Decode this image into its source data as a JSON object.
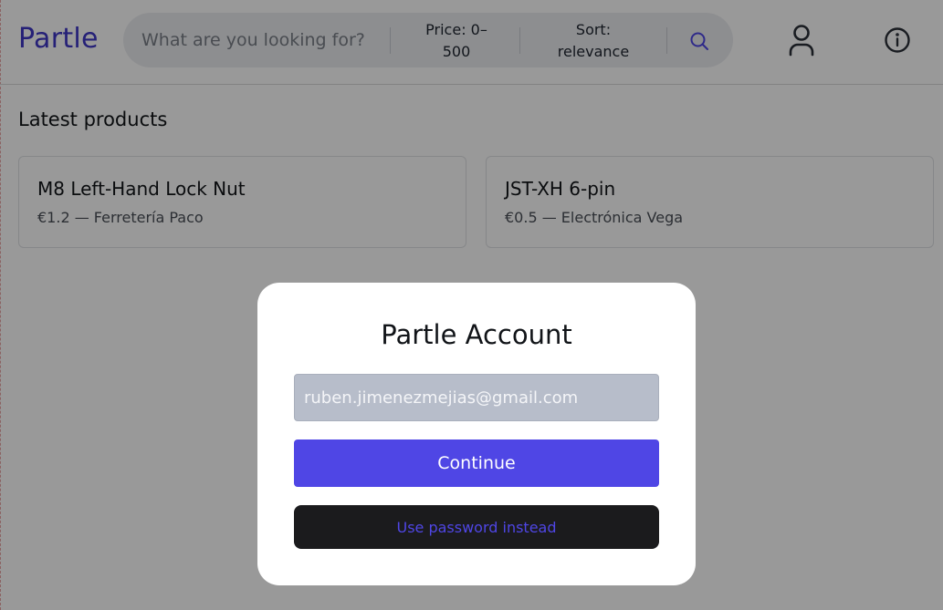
{
  "header": {
    "logo": "Partle",
    "search": {
      "placeholder": "What are you looking for?",
      "value": ""
    },
    "price_filter": {
      "line1": "Price: 0–",
      "line2": "500"
    },
    "sort_filter": {
      "line1": "Sort:",
      "line2": "relevance"
    },
    "icons": {
      "search": "search-icon",
      "user": "user-icon",
      "info": "info-icon"
    }
  },
  "main": {
    "section_title": "Latest products",
    "products": [
      {
        "name": "M8 Left-Hand Lock Nut",
        "meta": "€1.2 — Ferretería Paco"
      },
      {
        "name": "JST-XH 6-pin",
        "meta": "€0.5 — Electrónica Vega"
      }
    ]
  },
  "modal": {
    "title": "Partle Account",
    "email_value": "ruben.jimenezmejias@gmail.com",
    "continue_label": "Continue",
    "password_label": "Use password instead"
  },
  "colors": {
    "accent": "#4f46e5",
    "logo": "#3f36c7",
    "dark_button": "#1b1b1d",
    "overlay": "rgba(0,0,0,0.40)"
  }
}
